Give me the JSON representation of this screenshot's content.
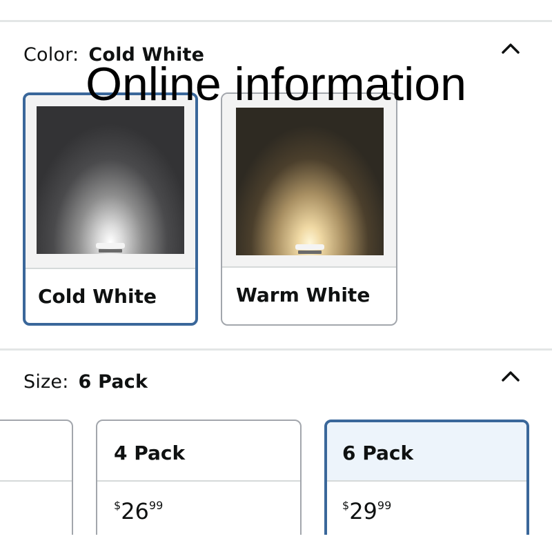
{
  "overlay_text": "Online information",
  "color_section": {
    "label": "Color:",
    "selected_value": "Cold White",
    "options": [
      {
        "name": "Cold White",
        "selected": true
      },
      {
        "name": "Warm White",
        "selected": false
      }
    ]
  },
  "size_section": {
    "label": "Size:",
    "selected_value": "6 Pack",
    "options": [
      {
        "name": "",
        "selected": false
      },
      {
        "name": "4 Pack",
        "price_symbol": "$",
        "price_whole": "26",
        "price_fraction": "99",
        "selected": false
      },
      {
        "name": "6 Pack",
        "price_symbol": "$",
        "price_whole": "29",
        "price_fraction": "99",
        "selected": true
      }
    ]
  },
  "colors": {
    "selected_border": "#3a679a",
    "selected_header_bg": "#edf4fb",
    "default_border": "#a2a6ac",
    "divider": "#e3e6e6"
  },
  "icons": {
    "collapse": "chevron-up-icon"
  }
}
